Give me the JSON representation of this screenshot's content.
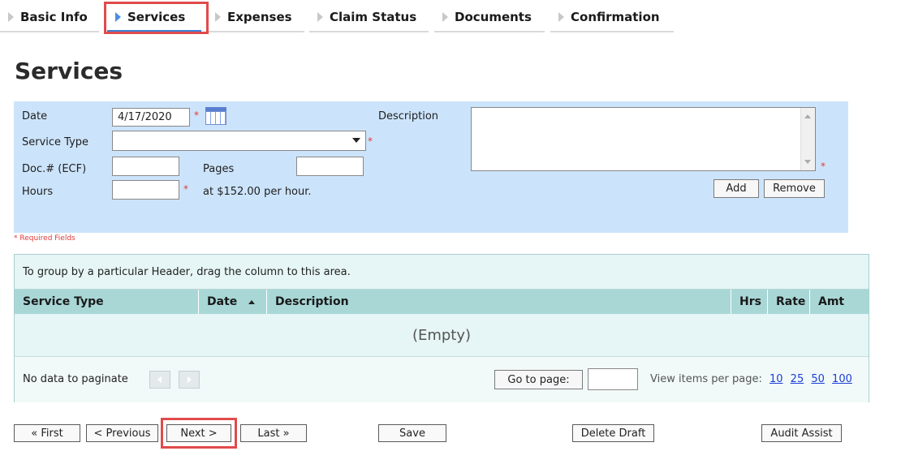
{
  "tabs": [
    {
      "label": "Basic Info",
      "active": false
    },
    {
      "label": "Services",
      "active": true
    },
    {
      "label": "Expenses",
      "active": false
    },
    {
      "label": "Claim Status",
      "active": false
    },
    {
      "label": "Documents",
      "active": false
    },
    {
      "label": "Confirmation",
      "active": false
    }
  ],
  "page_title": "Services",
  "form": {
    "date_label": "Date",
    "date_value": "4/17/2020",
    "service_type_label": "Service Type",
    "service_type_value": "",
    "doc_label": "Doc.# (ECF)",
    "doc_value": "",
    "pages_label": "Pages",
    "pages_value": "",
    "hours_label": "Hours",
    "hours_value": "",
    "rate_text": "at $152.00 per hour.",
    "description_label": "Description",
    "description_value": "",
    "required_marker": "*",
    "add_label": "Add",
    "remove_label": "Remove",
    "required_note": "* Required Fields"
  },
  "grid": {
    "group_hint": "To group by a particular Header, drag the column to this area.",
    "columns": [
      "Service Type",
      "Date",
      "Description",
      "Hrs",
      "Rate",
      "Amt"
    ],
    "sort_column": "Date",
    "sort_direction": "ascending",
    "empty_text": "(Empty)",
    "pager": {
      "no_data_text": "No data to paginate",
      "goto_label": "Go to page:",
      "goto_value": "",
      "items_per_page_label": "View items per page:",
      "page_sizes": [
        "10",
        "25",
        "50",
        "100"
      ]
    }
  },
  "actions": {
    "first": "« First",
    "previous": "< Previous",
    "next": "Next >",
    "last": "Last »",
    "save": "Save",
    "delete_draft": "Delete Draft",
    "audit_assist": "Audit Assist"
  },
  "colors": {
    "highlight": "#e04b4b",
    "form_panel": "#cce4fb",
    "grid_header": "#a8d7d6",
    "link": "#1a3fd6"
  }
}
